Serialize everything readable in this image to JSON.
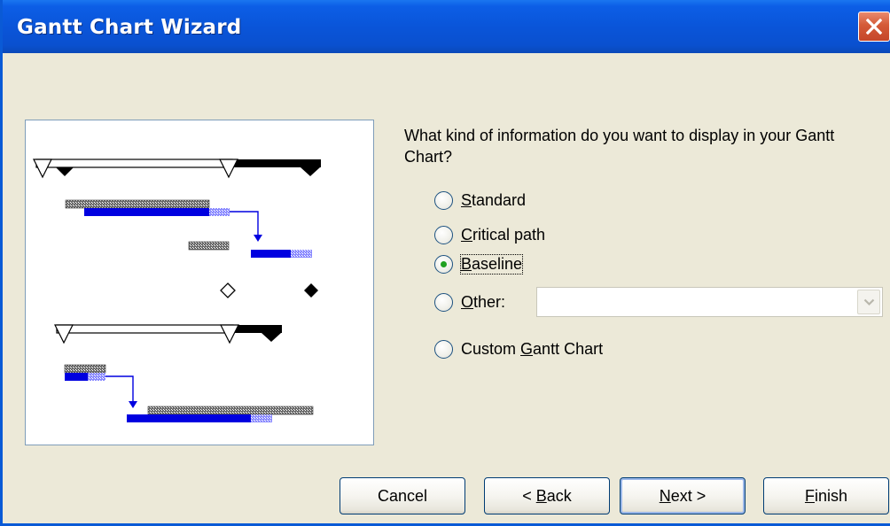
{
  "window": {
    "title": "Gantt Chart Wizard"
  },
  "main": {
    "question": "What kind of information do you want to display in your Gantt Chart?",
    "options": [
      {
        "pre": "",
        "key": "S",
        "post": "tandard",
        "checked": false
      },
      {
        "pre": "",
        "key": "C",
        "post": "ritical path",
        "checked": false
      },
      {
        "pre": "",
        "key": "B",
        "post": "aseline",
        "checked": true
      },
      {
        "pre": "",
        "key": "O",
        "post": "ther:",
        "checked": false
      },
      {
        "pre": "Custom ",
        "key": "G",
        "post": "antt Chart",
        "checked": false
      }
    ],
    "other_value": ""
  },
  "buttons": {
    "cancel": {
      "pre": "Cancel",
      "key": "",
      "post": ""
    },
    "back": {
      "pre": "< ",
      "key": "B",
      "post": "ack"
    },
    "next": {
      "pre": "",
      "key": "N",
      "post": "ext >"
    },
    "finish": {
      "pre": "",
      "key": "F",
      "post": "inish"
    }
  },
  "colors": {
    "title_bar": "#0a55d9",
    "close_button": "#d45a37",
    "task_bar": "#0000e0",
    "baseline_bar": "#555555",
    "summary_bar": "#000000"
  },
  "icons": {
    "close": "close-icon",
    "combo_arrow": "chevron-down-icon",
    "milestone": "diamond-icon"
  }
}
